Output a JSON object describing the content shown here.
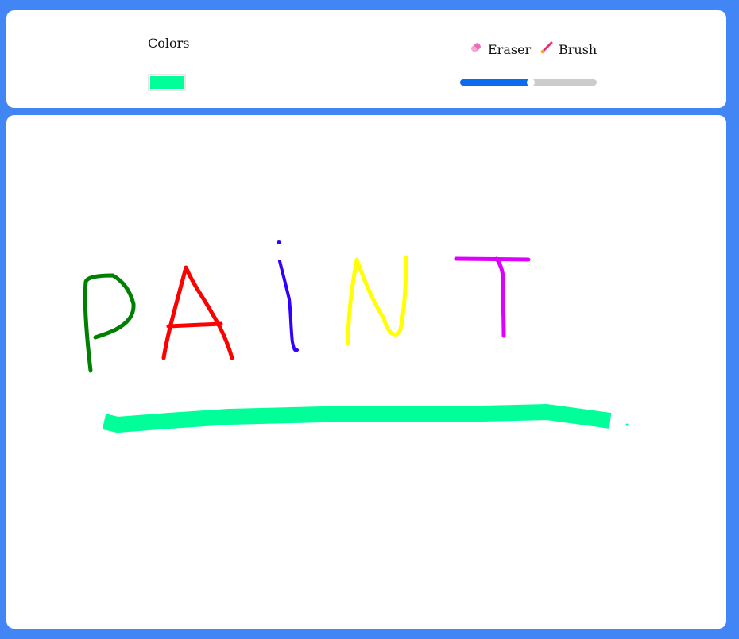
{
  "toolbar": {
    "colors_label": "Colors",
    "color_value": "#00ff99",
    "eraser_label": "Eraser",
    "brush_label": "Brush",
    "brush_size_fraction": 0.52,
    "eraser_icon": "eraser-icon",
    "brush_icon": "brush-icon",
    "slider_colors": {
      "fill": "#0b6cf0",
      "track": "#cccccc"
    }
  },
  "canvas": {
    "background": "#ffffff",
    "stroke_colors": {
      "P": "#008000",
      "A": "#ff0000",
      "I": "#3300ff",
      "N": "#ffff00",
      "T": "#dd00ff",
      "underline": "#00ff99"
    }
  },
  "page": {
    "background": "#4285f4"
  }
}
